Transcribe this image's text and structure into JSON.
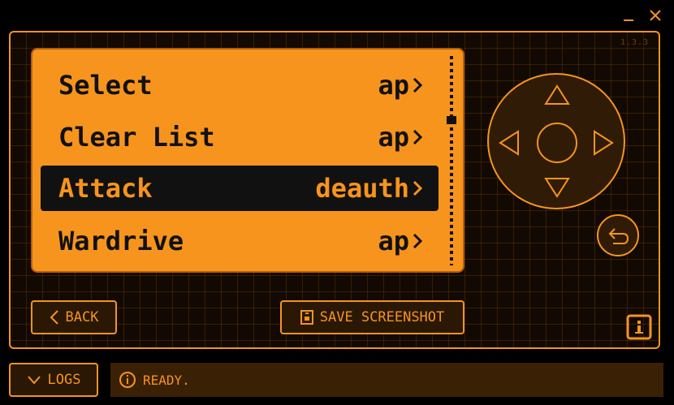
{
  "window": {
    "minimize_icon": "minimize-icon",
    "close_icon": "close-icon",
    "version": "1.3.3"
  },
  "menu": {
    "items": [
      {
        "label": "Select",
        "value": "ap",
        "selected": false
      },
      {
        "label": "Clear List",
        "value": "ap",
        "selected": false
      },
      {
        "label": "Attack",
        "value": "deauth",
        "selected": true
      },
      {
        "label": "Wardrive",
        "value": "ap",
        "selected": false
      }
    ],
    "scroll_position": 0.3
  },
  "controls": {
    "back_label": "BACK",
    "save_label": "SAVE SCREENSHOT"
  },
  "footer": {
    "logs_label": "LOGS",
    "status_text": "READY."
  },
  "colors": {
    "accent": "#f7941d",
    "screen_bg": "#f7941d",
    "selected_row_bg": "#111111",
    "panel_bg": "#301b06",
    "status_bg": "#3a2106"
  }
}
